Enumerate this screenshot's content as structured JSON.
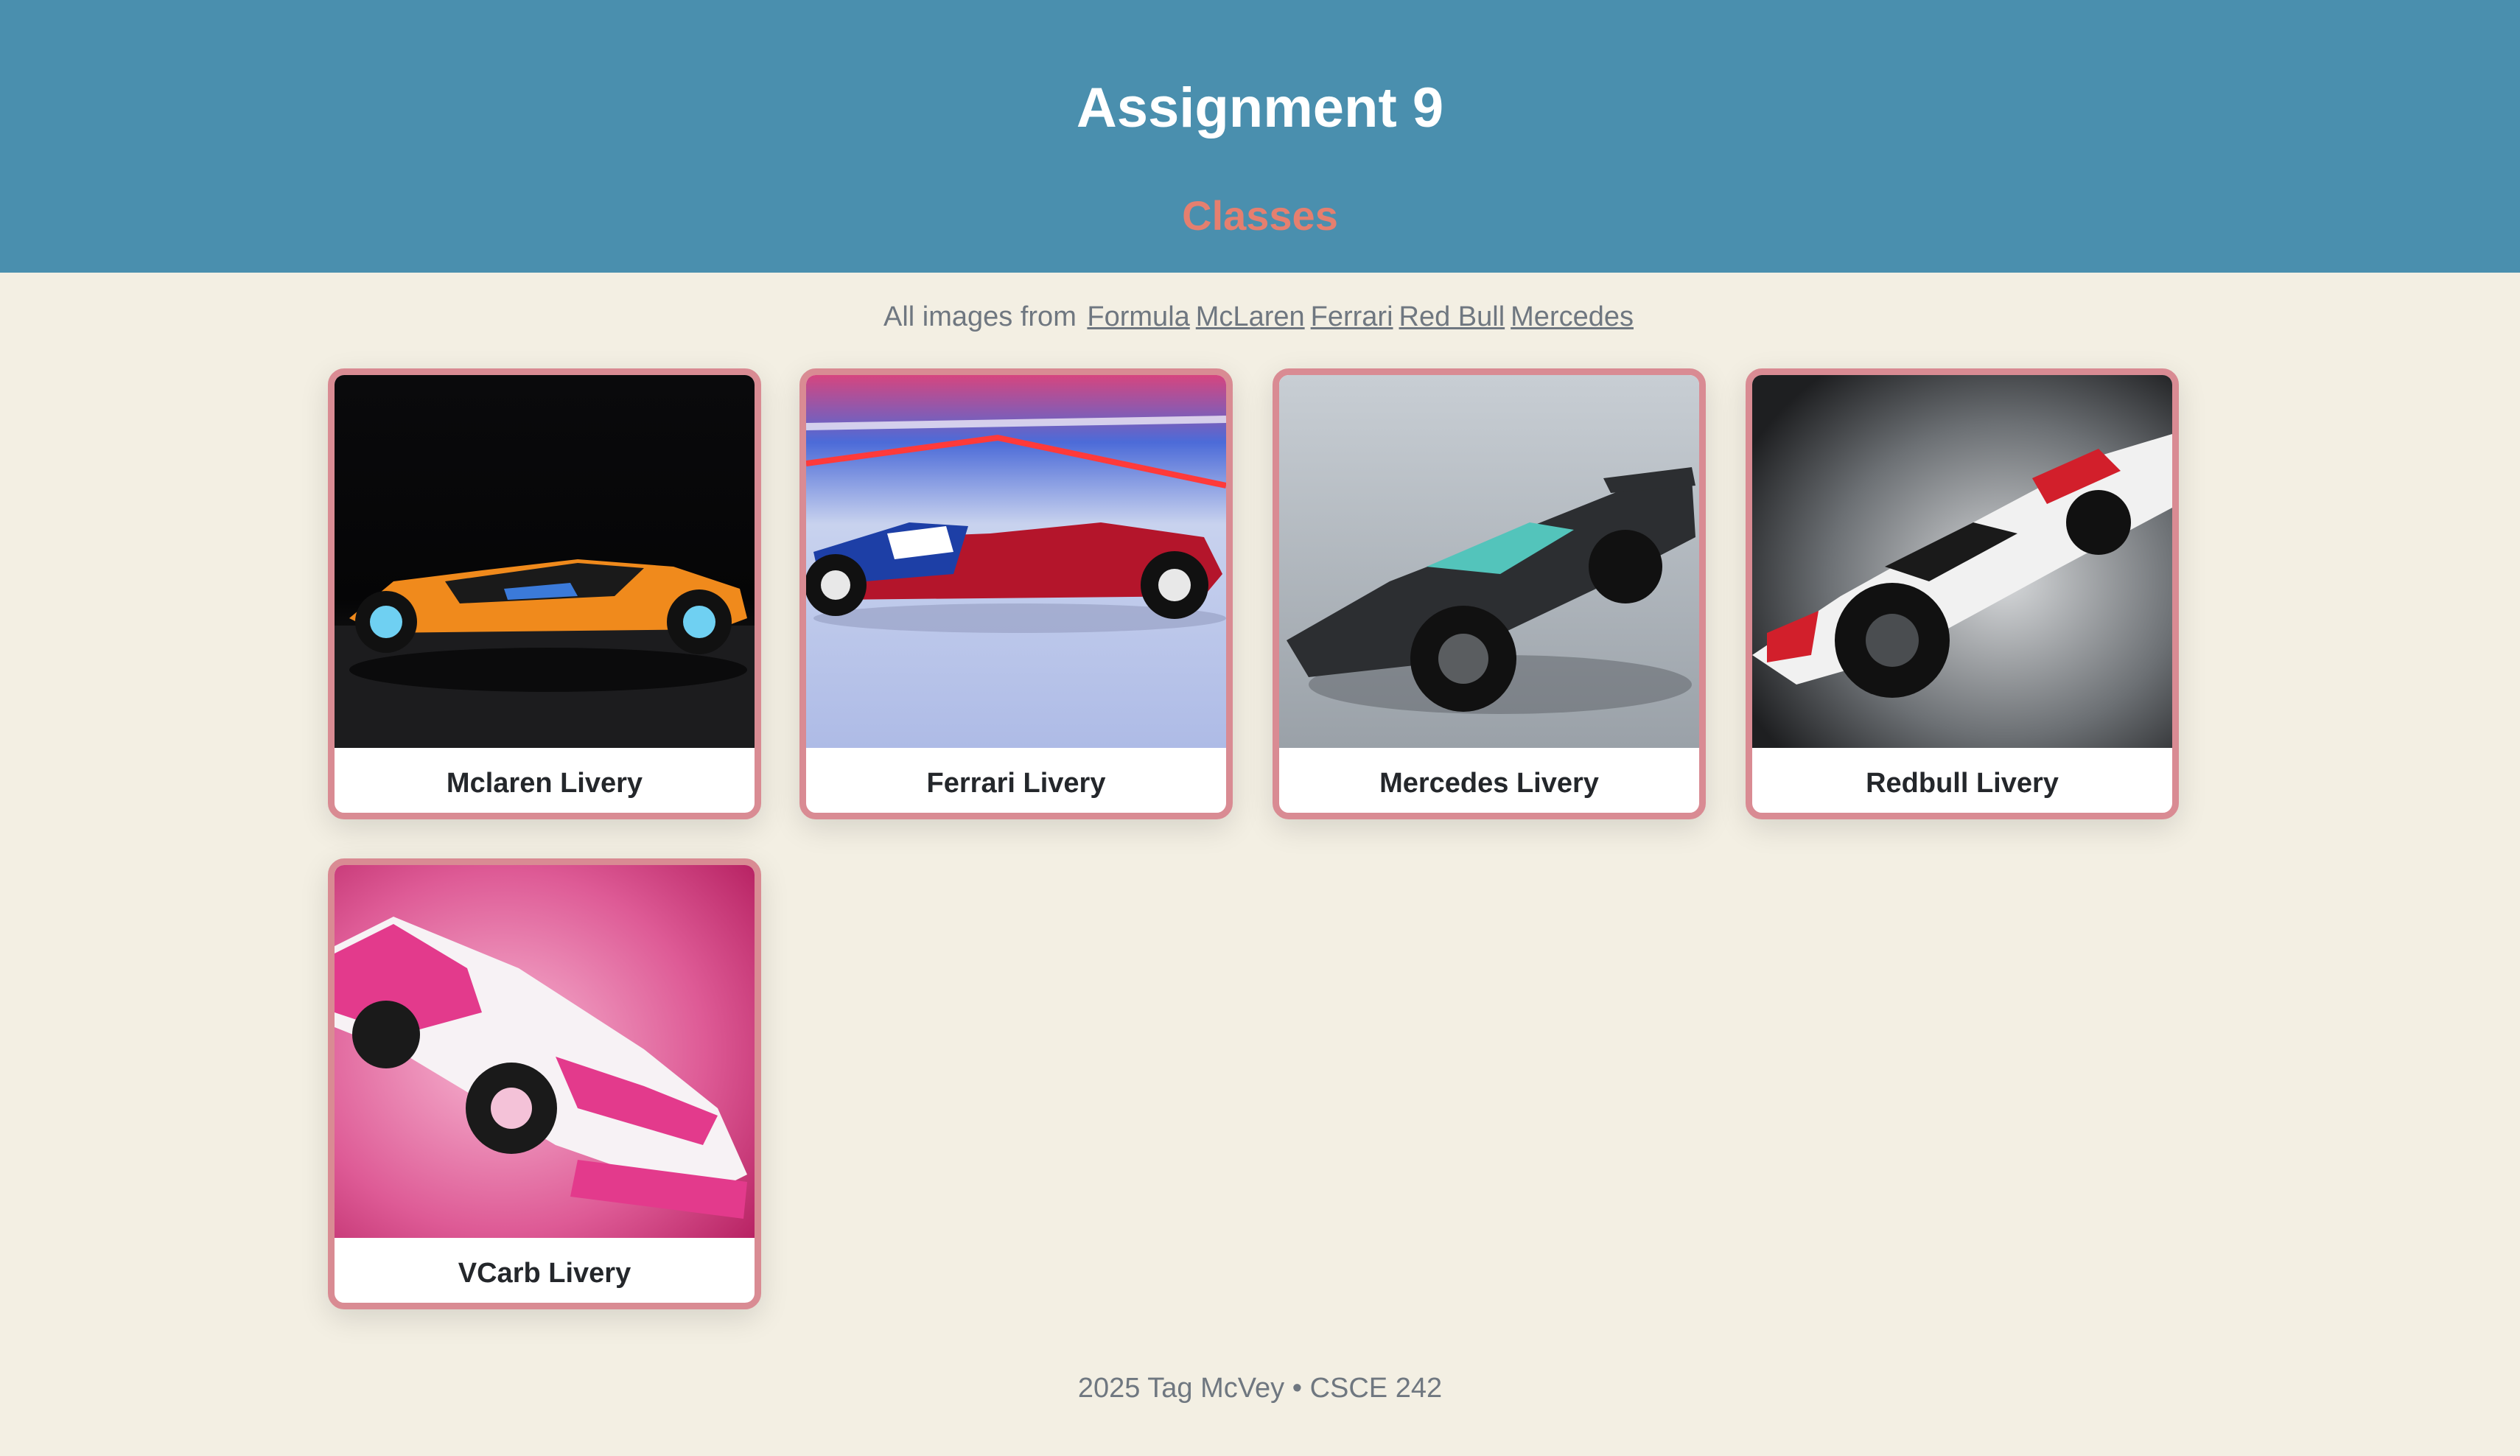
{
  "header": {
    "title": "Assignment 9",
    "subtitle": "Classes"
  },
  "credits": {
    "prefix": "All images from",
    "links": [
      "Formula",
      "McLaren",
      "Ferrari",
      "Red Bull",
      "Mercedes"
    ]
  },
  "cards": [
    {
      "label": "Mclaren Livery",
      "image": "mclaren-car-photo"
    },
    {
      "label": "Ferrari Livery",
      "image": "ferrari-car-photo"
    },
    {
      "label": "Mercedes Livery",
      "image": "mercedes-car-photo"
    },
    {
      "label": "Redbull Livery",
      "image": "redbull-car-photo"
    },
    {
      "label": "VCarb Livery",
      "image": "vcarb-car-photo"
    }
  ],
  "footer": {
    "text": "2025 Tag McVey • CSCE 242"
  },
  "colors": {
    "header_bg": "#4a8fae",
    "subtitle": "#e57f6f",
    "page_bg": "#f3efe3",
    "card_border": "#d98b93"
  }
}
